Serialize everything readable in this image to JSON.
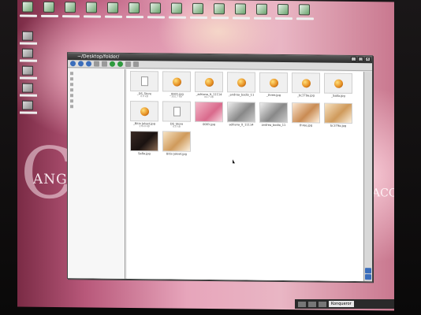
{
  "window": {
    "title": "~/Desktop/folder/",
    "buttons": [
      "_",
      "□",
      "×"
    ]
  },
  "sidebar": {
    "items": [
      "",
      "",
      "",
      "",
      "",
      "",
      ""
    ]
  },
  "files": [
    {
      "name": "_DS_Store",
      "size": "6.0 kB",
      "kind": "doc"
    },
    {
      "name": "_0001.jpg",
      "size": "355.7 kB",
      "kind": "ball"
    },
    {
      "name": "_adriana_lt_11114",
      "size": "84.7 kB",
      "kind": "ball"
    },
    {
      "name": "_andrea_bodio_11",
      "size": "",
      "kind": "ball"
    },
    {
      "name": "_three.jpg",
      "size": "",
      "kind": "ball"
    },
    {
      "name": "_bc379a.jpg",
      "size": "",
      "kind": "ball"
    },
    {
      "name": "_Sa8a.jpg",
      "size": "",
      "kind": "ball"
    },
    {
      "name": "_Bitix Jeleet.jpg",
      "size": "179.8 kB",
      "kind": "ball"
    },
    {
      "name": "DS_Store",
      "size": "6.0 kB",
      "kind": "doc"
    },
    {
      "name": "0001.jpg",
      "size": "",
      "kind": "ph-pink"
    },
    {
      "name": "adriana_lt_11114",
      "size": "",
      "kind": "ph-gray"
    },
    {
      "name": "andrea_bodio_11",
      "size": "",
      "kind": "ph-gray"
    },
    {
      "name": "three.jpg",
      "size": "",
      "kind": "ph-skin"
    },
    {
      "name": "bc379a.jpg",
      "size": "",
      "kind": "ph-tan"
    },
    {
      "name": "Sa8a.jpg",
      "size": "",
      "kind": "ph-dark"
    },
    {
      "name": "Bitix Jeleet.jpg",
      "size": "",
      "kind": "ph-tan"
    }
  ],
  "desktop": {
    "wallpaper_text_left": "ANGE",
    "wallpaper_letter": "C",
    "wallpaper_text_right": "ACC"
  },
  "taskbar": {
    "active_label": "Konqueror"
  }
}
